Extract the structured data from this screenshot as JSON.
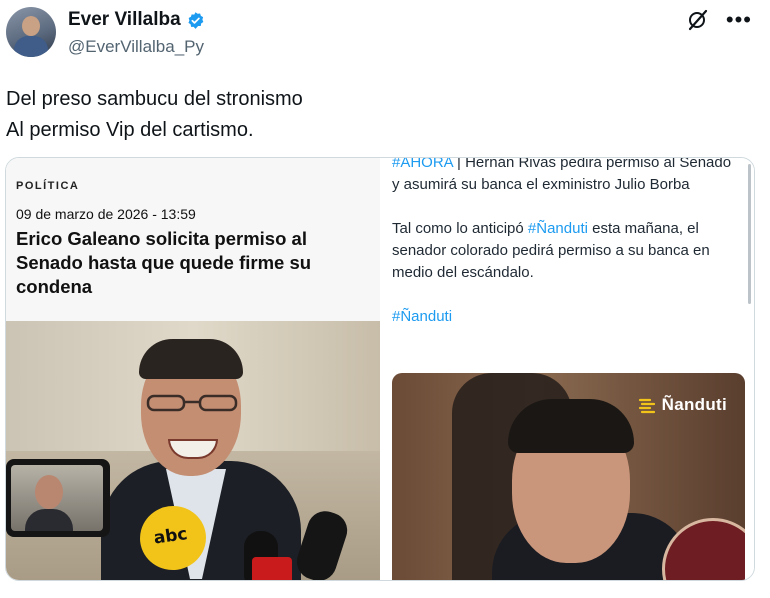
{
  "author": {
    "display_name": "Ever Villalba",
    "handle": "@EverVillalba_Py"
  },
  "icons": {
    "verified": "verified-badge-icon",
    "grok": "grok-icon",
    "more": "more-icon"
  },
  "tweet": {
    "lines": [
      "Del preso sambucu del stronismo",
      "Al permiso Vip del cartismo."
    ]
  },
  "left_card": {
    "section": "POLÍTICA",
    "date": "09 de marzo de 2026 - 13:59",
    "headline": "Erico Galeano solicita permiso al Senado hasta que quede firme su condena",
    "mic_brand": "abc"
  },
  "right_card": {
    "tag": "#AHORA",
    "separator": " | ",
    "intro": "Hernán Rivas pedirá permiso al Senado y asumirá su banca el exministro Julio Borba",
    "p2_before": "Tal como lo anticipó ",
    "p2_tag": "#Ñanduti",
    "p2_after": " esta mañana, el senador colorado pedirá permiso a su banca en medio del escándalo.",
    "hashtag": "#Ñanduti",
    "logo_text": "Ñanduti"
  },
  "colors": {
    "verified": "#1d9bf0",
    "link": "#1d9bf0",
    "text": "#0f1419",
    "muted": "#536471",
    "abc_mic": "#f2c419"
  }
}
